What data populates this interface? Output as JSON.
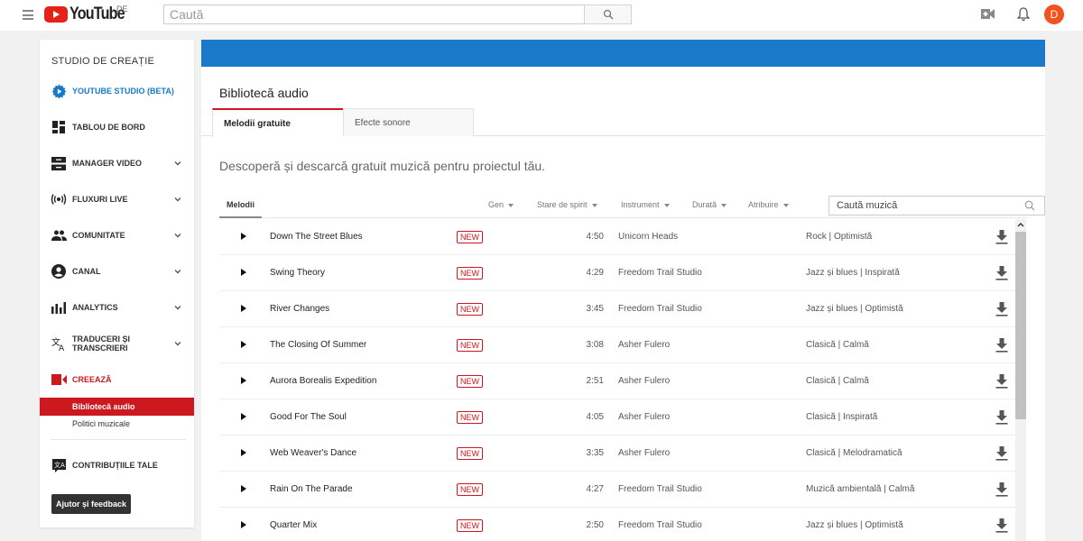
{
  "header": {
    "logo_text": "YouTube",
    "region": "DE",
    "search_placeholder": "Caută",
    "avatar_letter": "D",
    "icons": [
      "menu-icon",
      "search-icon",
      "create-video-icon",
      "bell-icon"
    ]
  },
  "sidebar": {
    "title": "STUDIO DE CREAȚIE",
    "items": [
      {
        "label": "YOUTUBE STUDIO (BETA)",
        "icon": "gear-icon",
        "expandable": false
      },
      {
        "label": "TABLOU DE BORD",
        "icon": "dashboard-icon",
        "expandable": false
      },
      {
        "label": "MANAGER VIDEO",
        "icon": "video-manager-icon",
        "expandable": true
      },
      {
        "label": "FLUXURI LIVE",
        "icon": "live-icon",
        "expandable": true
      },
      {
        "label": "COMUNITATE",
        "icon": "community-icon",
        "expandable": true
      },
      {
        "label": "CANAL",
        "icon": "account-icon",
        "expandable": true
      },
      {
        "label": "ANALYTICS",
        "icon": "analytics-icon",
        "expandable": true
      },
      {
        "label": "TRADUCERI ȘI TRANSCRIERI",
        "label_line1": "TRADUCERI ȘI",
        "label_line2": "TRANSCRIERI",
        "icon": "translate-icon",
        "expandable": true
      },
      {
        "label": "CREEAZĂ",
        "icon": "create-icon",
        "expandable": false
      }
    ],
    "sub_items": [
      {
        "label": "Bibliotecă audio",
        "active": true
      },
      {
        "label": "Politici muzicale",
        "active": false
      }
    ],
    "contributions": {
      "label": "CONTRIBUȚIILE TALE",
      "icon": "contributions-icon"
    },
    "help_button": "Ajutor și feedback"
  },
  "main": {
    "banner_color": "#1a7ac9",
    "title": "Bibliotecă audio",
    "tabs": [
      {
        "label": "Melodii gratuite",
        "active": true
      },
      {
        "label": "Efecte sonore",
        "active": false
      }
    ],
    "subtitle": "Descoperă și descarcă gratuit muzică pentru proiectul tău.",
    "list_tab": "Melodii",
    "filters": [
      "Gen",
      "Stare de spirit",
      "Instrument",
      "Durată",
      "Atribuire"
    ],
    "music_search_placeholder": "Caută muzică",
    "badge_label": "NEW",
    "tracks": [
      {
        "title": "Down The Street Blues",
        "duration": "4:50",
        "artist": "Unicorn Heads",
        "genre": "Rock | Optimistă"
      },
      {
        "title": "Swing Theory",
        "duration": "4:29",
        "artist": "Freedom Trail Studio",
        "genre": "Jazz și blues | Inspirată"
      },
      {
        "title": "River Changes",
        "duration": "3:45",
        "artist": "Freedom Trail Studio",
        "genre": "Jazz și blues | Optimistă"
      },
      {
        "title": "The Closing Of Summer",
        "duration": "3:08",
        "artist": "Asher Fulero",
        "genre": "Clasică | Calmă"
      },
      {
        "title": "Aurora Borealis Expedition",
        "duration": "2:51",
        "artist": "Asher Fulero",
        "genre": "Clasică | Calmă"
      },
      {
        "title": "Good For The Soul",
        "duration": "4:05",
        "artist": "Asher Fulero",
        "genre": "Clasică | Inspirată"
      },
      {
        "title": "Web Weaver's Dance",
        "duration": "3:35",
        "artist": "Asher Fulero",
        "genre": "Clasică | Melodramatică"
      },
      {
        "title": "Rain On The Parade",
        "duration": "4:27",
        "artist": "Freedom Trail Studio",
        "genre": "Muzică ambientală | Calmă"
      },
      {
        "title": "Quarter Mix",
        "duration": "2:50",
        "artist": "Freedom Trail Studio",
        "genre": "Jazz și blues | Optimistă"
      }
    ]
  }
}
